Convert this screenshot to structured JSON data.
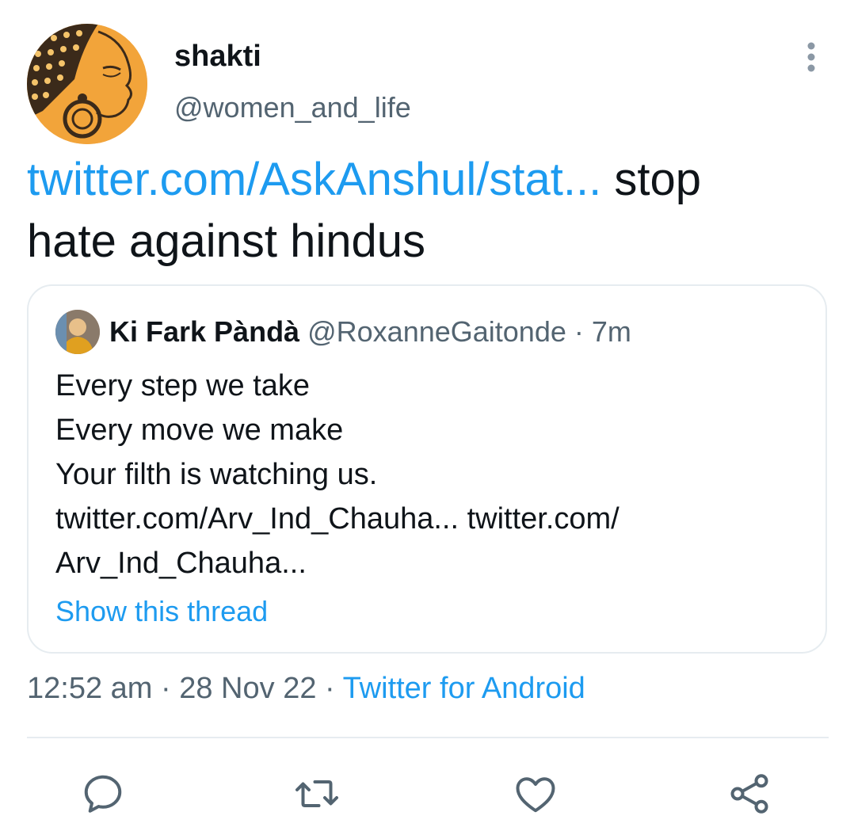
{
  "author": {
    "display_name": "shakti",
    "handle": "@women_and_life",
    "avatar_icon": "illustrated-woman-avatar"
  },
  "tweet": {
    "link_text": "twitter.com/AskAnshul/stat...",
    "text_line1_suffix": " stop",
    "text_line2": "hate against hindus"
  },
  "quoted_tweet": {
    "display_name": "Ki Fark Pàndà",
    "handle": "@RoxanneGaitonde",
    "separator": " · ",
    "time": "7m",
    "lines": [
      "Every step we take",
      "Every move we make",
      "Your filth is watching us.",
      "twitter.com/Arv_Ind_Chauha... twitter.com/",
      "Arv_Ind_Chauha..."
    ],
    "show_thread": "Show this thread"
  },
  "meta": {
    "time": "12:52 am",
    "separator": " · ",
    "date": "28 Nov 22",
    "source": "Twitter for Android"
  },
  "actions": {
    "reply_icon": "reply-icon",
    "retweet_icon": "retweet-icon",
    "like_icon": "heart-icon",
    "share_icon": "share-icon"
  },
  "colors": {
    "accent": "#1d9bf0",
    "text": "#0f1419",
    "secondary": "#536471",
    "border": "#e6ecf0"
  }
}
